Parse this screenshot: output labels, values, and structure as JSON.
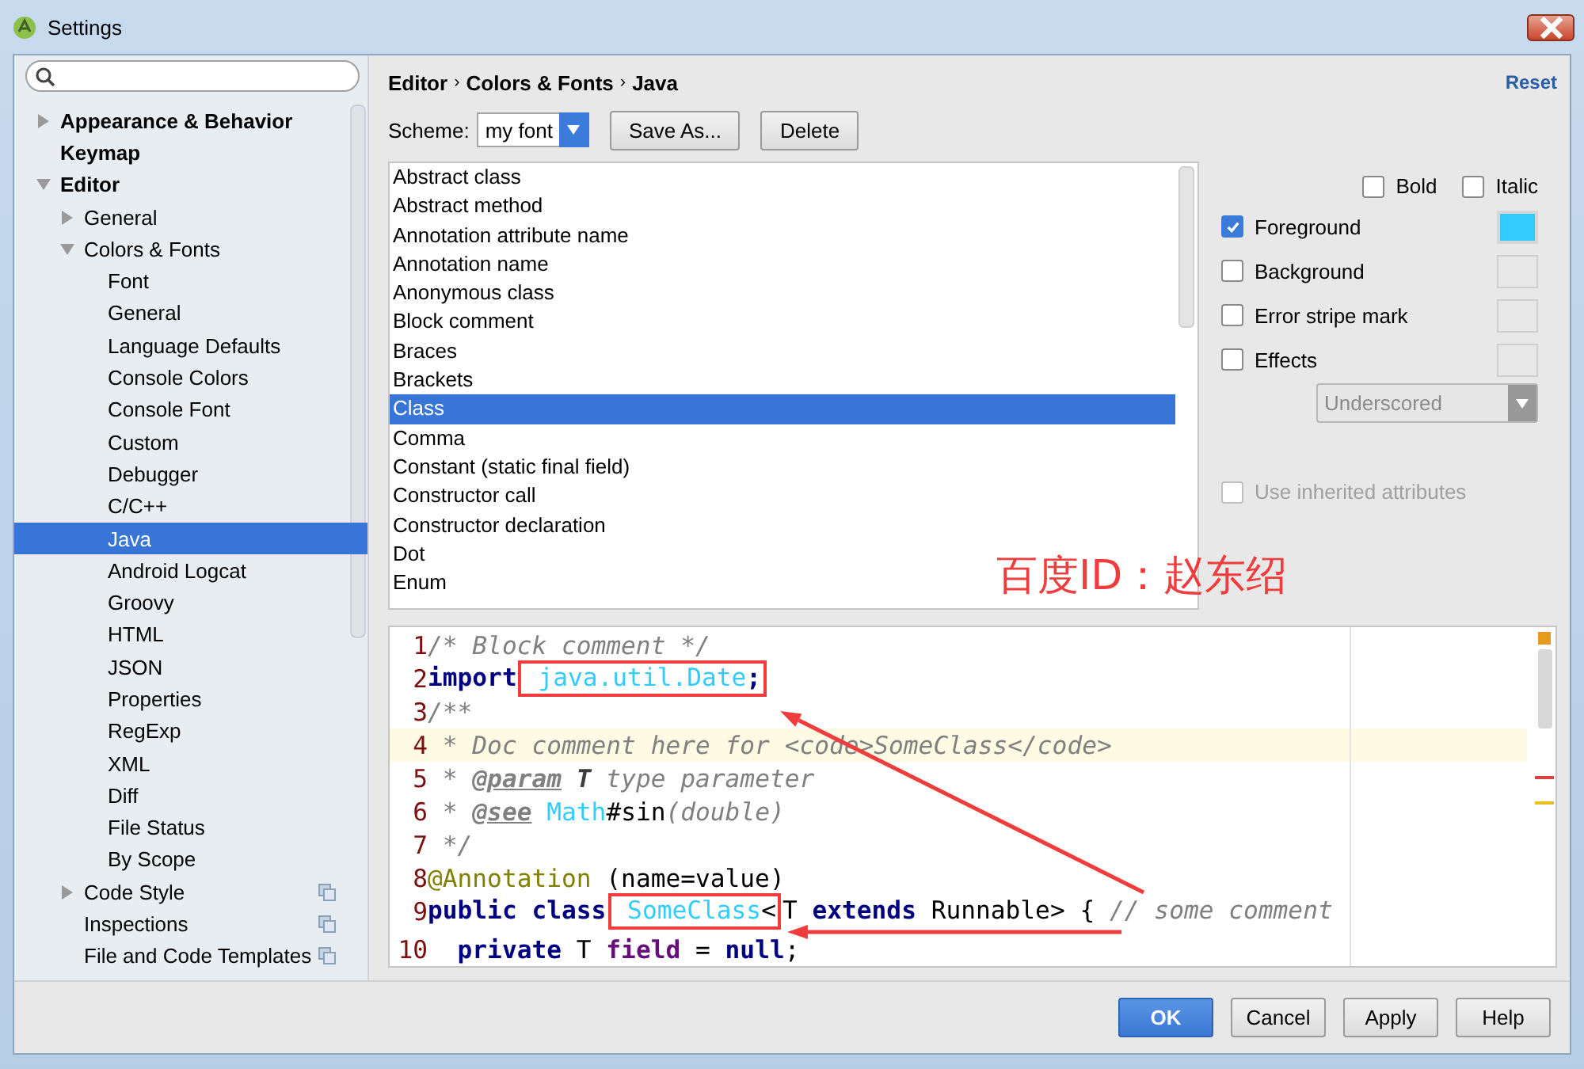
{
  "window": {
    "title": "Settings"
  },
  "sidebar": {
    "items": [
      {
        "label": "Appearance & Behavior",
        "expanded": false,
        "selected": false
      },
      {
        "label": "Keymap",
        "selected": false
      },
      {
        "label": "Editor",
        "expanded": true,
        "selected": false,
        "children": [
          {
            "label": "General",
            "expanded": false,
            "selected": false
          },
          {
            "label": "Colors & Fonts",
            "expanded": true,
            "selected": false,
            "children": [
              {
                "label": "Font",
                "selected": false
              },
              {
                "label": "General",
                "selected": false
              },
              {
                "label": "Language Defaults",
                "selected": false
              },
              {
                "label": "Console Colors",
                "selected": false
              },
              {
                "label": "Console Font",
                "selected": false
              },
              {
                "label": "Custom",
                "selected": false
              },
              {
                "label": "Debugger",
                "selected": false
              },
              {
                "label": "C/C++",
                "selected": false
              },
              {
                "label": "Java",
                "selected": true
              },
              {
                "label": "Android Logcat",
                "selected": false
              },
              {
                "label": "Groovy",
                "selected": false
              },
              {
                "label": "HTML",
                "selected": false
              },
              {
                "label": "JSON",
                "selected": false
              },
              {
                "label": "Properties",
                "selected": false
              },
              {
                "label": "RegExp",
                "selected": false
              },
              {
                "label": "XML",
                "selected": false
              },
              {
                "label": "Diff",
                "selected": false
              },
              {
                "label": "File Status",
                "selected": false
              },
              {
                "label": "By Scope",
                "selected": false
              }
            ]
          },
          {
            "label": "Code Style",
            "expanded": false,
            "selected": false,
            "project_level": true
          },
          {
            "label": "Inspections",
            "selected": false,
            "project_level": true
          },
          {
            "label": "File and Code Templates",
            "selected": false,
            "project_level": true
          }
        ]
      }
    ]
  },
  "breadcrumb": [
    "Editor",
    "Colors & Fonts",
    "Java"
  ],
  "breadcrumb_separator": "›",
  "reset": "Reset",
  "scheme": {
    "label": "Scheme:",
    "value": "my font",
    "buttons": [
      "Save As...",
      "Delete"
    ]
  },
  "attributes": [
    {
      "label": "Abstract class",
      "selected": false
    },
    {
      "label": "Abstract method",
      "selected": false
    },
    {
      "label": "Annotation attribute name",
      "selected": false
    },
    {
      "label": "Annotation name",
      "selected": false
    },
    {
      "label": "Anonymous class",
      "selected": false
    },
    {
      "label": "Block comment",
      "selected": false
    },
    {
      "label": "Braces",
      "selected": false
    },
    {
      "label": "Brackets",
      "selected": false
    },
    {
      "label": "Class",
      "selected": true
    },
    {
      "label": "Comma",
      "selected": false
    },
    {
      "label": "Constant (static final field)",
      "selected": false
    },
    {
      "label": "Constructor call",
      "selected": false
    },
    {
      "label": "Constructor declaration",
      "selected": false
    },
    {
      "label": "Dot",
      "selected": false
    },
    {
      "label": "Enum",
      "selected": false
    }
  ],
  "style_options": [
    {
      "label": "Bold",
      "checked": false
    },
    {
      "label": "Italic",
      "checked": false
    }
  ],
  "color_options": [
    {
      "label": "Foreground",
      "checked": true,
      "color": "#33ccff"
    },
    {
      "label": "Background",
      "checked": false
    },
    {
      "label": "Error stripe mark",
      "checked": false
    },
    {
      "label": "Effects",
      "checked": false
    }
  ],
  "effect_type": {
    "value": "Underscored",
    "disabled": true
  },
  "inherit": {
    "label": "Use inherited attributes",
    "checked": false,
    "disabled": true
  },
  "preview": {
    "lines": [
      {
        "number": "1",
        "current": false,
        "tokens": [
          {
            "text": "/* Block comment */",
            "kind": "comment"
          }
        ]
      },
      {
        "number": "2",
        "current": false,
        "tokens": [
          {
            "text": "import",
            "kind": "keyword"
          },
          {
            "text": " java.util.Date",
            "kind": "class",
            "framed": true
          },
          {
            "text": ";",
            "kind": "keyword",
            "framed": true
          }
        ]
      },
      {
        "number": "3",
        "current": false,
        "tokens": [
          {
            "text": "/**",
            "kind": "doc"
          }
        ]
      },
      {
        "number": "4",
        "current": true,
        "tokens": [
          {
            "text": " * Doc comment here for <code>SomeClass</code>",
            "kind": "doc"
          }
        ]
      },
      {
        "number": "5",
        "current": false,
        "tokens": [
          {
            "text": " * ",
            "kind": "doc"
          },
          {
            "text": "@param",
            "kind": "doctag"
          },
          {
            "text": " T",
            "kind": "docparam"
          },
          {
            "text": " type parameter",
            "kind": "doc"
          }
        ]
      },
      {
        "number": "6",
        "current": false,
        "tokens": [
          {
            "text": " * ",
            "kind": "doc"
          },
          {
            "text": "@see",
            "kind": "doctag"
          },
          {
            "text": " Math",
            "kind": "class"
          },
          {
            "text": "#sin",
            "kind": "plain"
          },
          {
            "text": "(double)",
            "kind": "doc"
          }
        ]
      },
      {
        "number": "7",
        "current": false,
        "tokens": [
          {
            "text": " */",
            "kind": "doc"
          }
        ]
      },
      {
        "number": "8",
        "current": false,
        "tokens": [
          {
            "text": "@Annotation",
            "kind": "annotation"
          },
          {
            "text": " (name=value)",
            "kind": "plain"
          }
        ]
      },
      {
        "number": "9",
        "current": false,
        "tokens": [
          {
            "text": "public class",
            "kind": "keyword"
          },
          {
            "text": " SomeClass",
            "kind": "class",
            "framed": true
          },
          {
            "text": "<",
            "kind": "plain",
            "framed": true
          },
          {
            "text": "T ",
            "kind": "plain"
          },
          {
            "text": "extends",
            "kind": "keyword"
          },
          {
            "text": " Runnable> { ",
            "kind": "plain"
          },
          {
            "text": "// some comment",
            "kind": "comment"
          }
        ]
      },
      {
        "number": "10",
        "current": false,
        "tokens": [
          {
            "text": "  private",
            "kind": "keyword"
          },
          {
            "text": " T ",
            "kind": "plain"
          },
          {
            "text": "field",
            "kind": "field"
          },
          {
            "text": " = ",
            "kind": "plain"
          },
          {
            "text": "null",
            "kind": "keyword"
          },
          {
            "text": ";",
            "kind": "plain"
          }
        ]
      }
    ]
  },
  "annotation_label": "百度ID：赵东绍",
  "buttons": [
    {
      "label": "OK",
      "kind": "primary"
    },
    {
      "label": "Cancel",
      "kind": "normal"
    },
    {
      "label": "Apply",
      "kind": "normal"
    },
    {
      "label": "Help",
      "kind": "normal"
    }
  ]
}
